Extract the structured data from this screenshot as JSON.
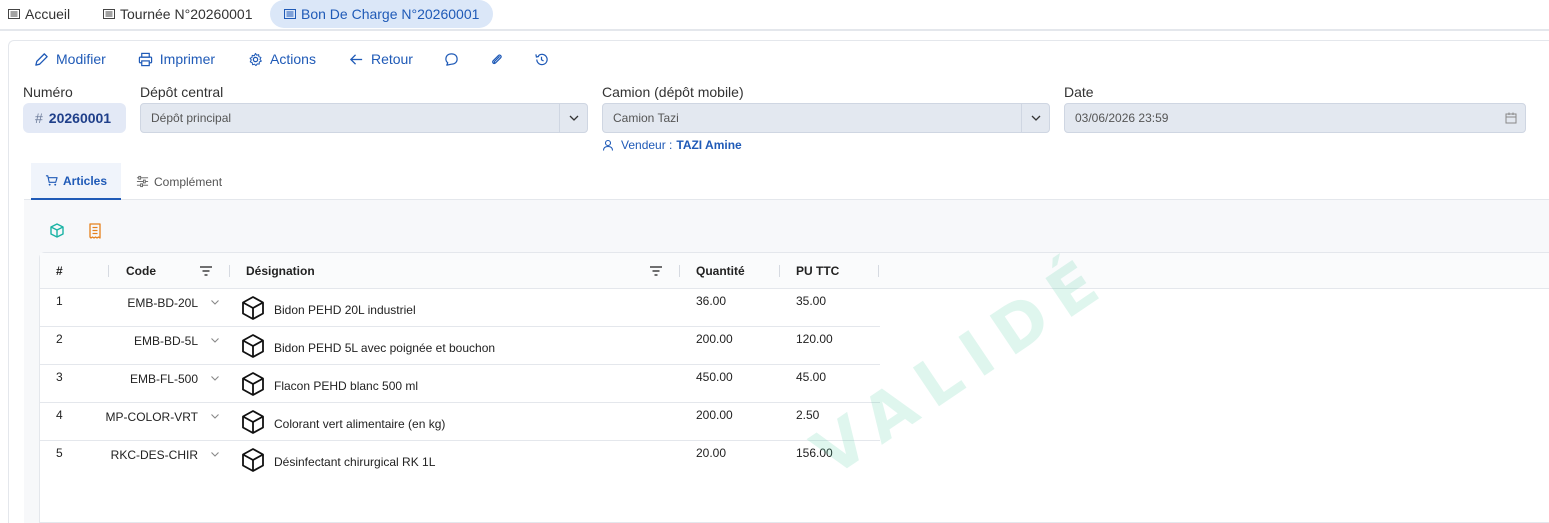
{
  "top_tabs": [
    {
      "label": "Accueil",
      "icon": "list-icon"
    },
    {
      "label": "Tournée N°20260001",
      "icon": "list-icon"
    },
    {
      "label": "Bon De Charge N°20260001",
      "icon": "list-icon",
      "active": true
    }
  ],
  "toolbar": {
    "modifier": "Modifier",
    "imprimer": "Imprimer",
    "actions": "Actions",
    "retour": "Retour"
  },
  "form": {
    "numero_label": "Numéro",
    "numero_value": "20260001",
    "depot_label": "Dépôt central",
    "depot_value": "Dépôt principal",
    "camion_label": "Camion (dépôt mobile)",
    "camion_value": "Camion Tazi",
    "date_label": "Date",
    "date_value": "03/06/2026 23:59",
    "vendeur_prefix": "Vendeur :",
    "vendeur_name": "TAZI Amine"
  },
  "content_tabs": [
    {
      "label": "Articles",
      "active": true
    },
    {
      "label": "Complément"
    }
  ],
  "table": {
    "headers": [
      "#",
      "Code",
      "Désignation",
      "Quantité",
      "PU TTC"
    ],
    "rows": [
      {
        "num": "1",
        "code": "EMB-BD-20L",
        "designation": "Bidon PEHD 20L industriel",
        "quantite": "36.00",
        "pu": "35.00"
      },
      {
        "num": "2",
        "code": "EMB-BD-5L",
        "designation": "Bidon PEHD 5L avec poignée et bouchon",
        "quantite": "200.00",
        "pu": "120.00"
      },
      {
        "num": "3",
        "code": "EMB-FL-500",
        "designation": "Flacon PEHD blanc 500 ml",
        "quantite": "450.00",
        "pu": "45.00"
      },
      {
        "num": "4",
        "code": "MP-COLOR-VRT",
        "designation": "Colorant vert alimentaire (en kg)",
        "quantite": "200.00",
        "pu": "2.50"
      },
      {
        "num": "5",
        "code": "RKC-DES-CHIR",
        "designation": "Désinfectant chirurgical RK 1L",
        "quantite": "20.00",
        "pu": "156.00"
      }
    ]
  },
  "watermark": "VALIDÉ",
  "colors": {
    "accent": "#1f5ab7",
    "watermark": "#50cda0"
  }
}
